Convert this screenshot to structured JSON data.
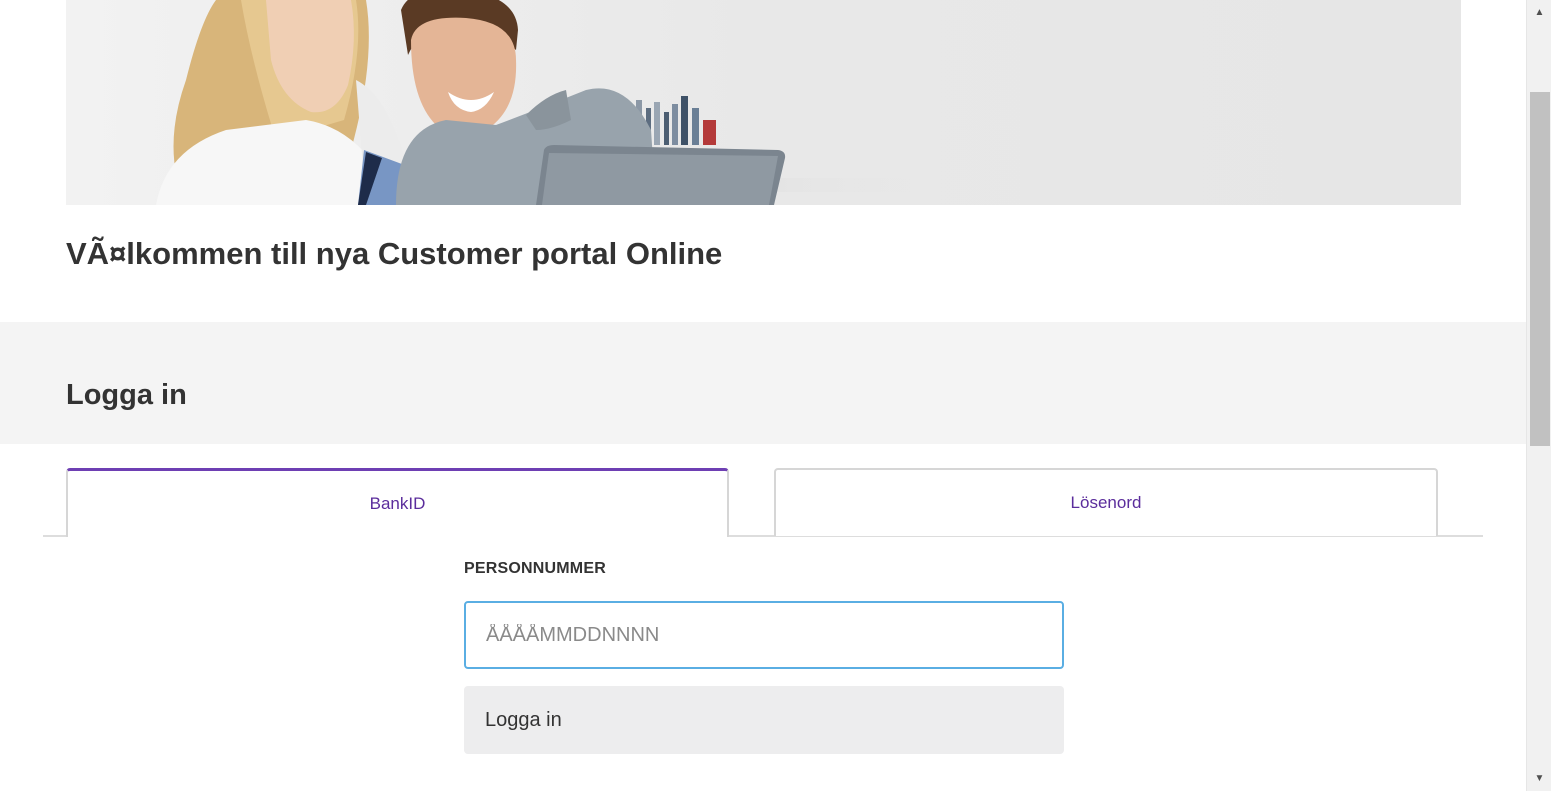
{
  "hero": {
    "image_description_icon": "couple-with-laptop-photo"
  },
  "welcome": {
    "title": "VÃ¤lkommen till nya Customer portal Online"
  },
  "login": {
    "heading": "Logga in",
    "tabs": [
      {
        "label": "BankID",
        "active": true
      },
      {
        "label": "Lösenord",
        "active": false
      }
    ],
    "personnummer_label": "PERSONNUMMER",
    "personnummer_placeholder": "ÅÅÅÅMMDDNNNN",
    "personnummer_value": "",
    "submit_label": "Logga in"
  },
  "colors": {
    "accent_purple": "#6e3fb3",
    "tab_text": "#5b2d9c",
    "input_focus": "#5aaee3",
    "band_bg": "#f4f4f4",
    "button_bg": "#ededee"
  },
  "scrollbar": {
    "up_icon": "scroll-up-arrow-icon",
    "down_icon": "scroll-down-arrow-icon"
  }
}
